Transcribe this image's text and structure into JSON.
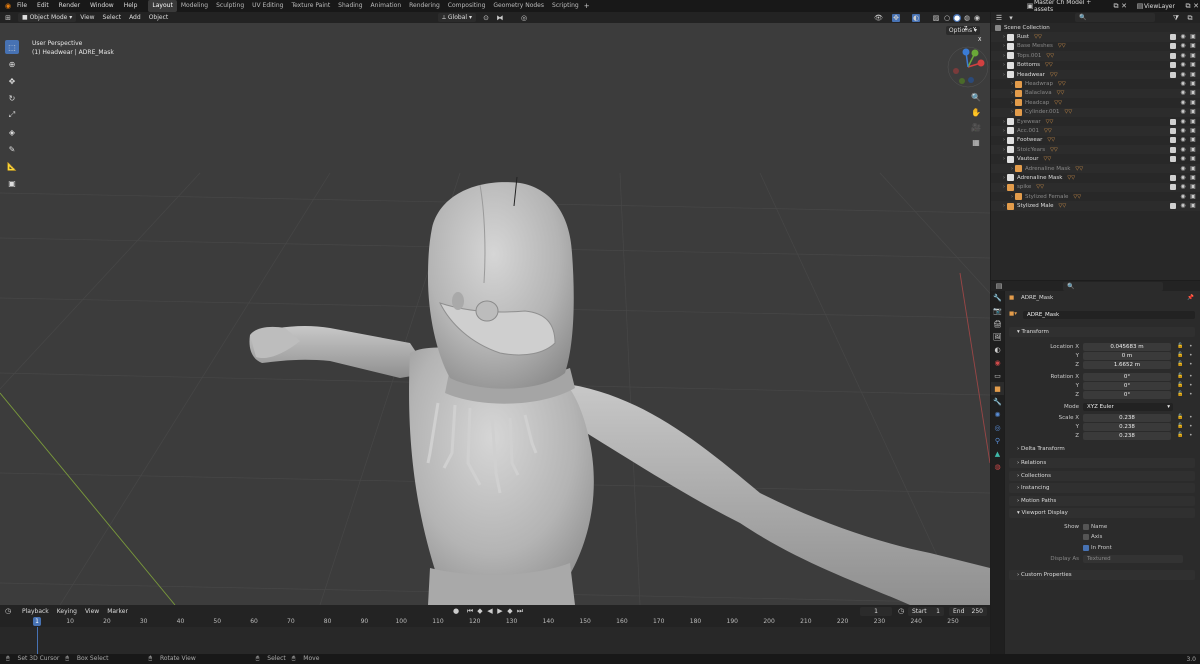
{
  "topbar": {
    "menus": [
      "File",
      "Edit",
      "Render",
      "Window",
      "Help"
    ],
    "workspaces": [
      "Layout",
      "Modeling",
      "Sculpting",
      "UV Editing",
      "Texture Paint",
      "Shading",
      "Animation",
      "Rendering",
      "Compositing",
      "Geometry Nodes",
      "Scripting"
    ],
    "active_workspace": "Layout",
    "scene_name": "Master Ch Model + assets",
    "view_layer": "ViewLayer"
  },
  "viewport_header": {
    "mode": "Object Mode",
    "menus": [
      "View",
      "Select",
      "Add",
      "Object"
    ],
    "transform_orientation": "Global",
    "options": "Options"
  },
  "viewport": {
    "perspective": "User Perspective",
    "object_info": "(1) Headwear | ADRE_Mask",
    "gizmo": {
      "x": "X",
      "y": "Y",
      "z": "Z"
    }
  },
  "timeline": {
    "menus": [
      "Playback",
      "Keying",
      "View",
      "Marker"
    ],
    "current_frame": "1",
    "start_label": "Start",
    "start": "1",
    "end_label": "End",
    "end": "250",
    "ticks": [
      "1",
      "10",
      "20",
      "30",
      "40",
      "50",
      "60",
      "70",
      "80",
      "90",
      "100",
      "110",
      "120",
      "130",
      "140",
      "150",
      "160",
      "170",
      "180",
      "190",
      "200",
      "210",
      "220",
      "230",
      "240",
      "250"
    ]
  },
  "statusbar": {
    "items": [
      "Set 3D Cursor",
      "Box Select",
      "Rotate View",
      "Select",
      "Move"
    ],
    "version": "3.0"
  },
  "outliner": {
    "root": "Scene Collection",
    "rows": [
      {
        "name": "Rust",
        "depth": 0,
        "dim": false,
        "icon_color": "#e0e0e0"
      },
      {
        "name": "Base Meshes",
        "depth": 0,
        "dim": true,
        "icon_color": "#e0e0e0"
      },
      {
        "name": "Tops.001",
        "depth": 0,
        "dim": true,
        "icon_color": "#e0e0e0"
      },
      {
        "name": "Bottoms",
        "depth": 0,
        "dim": false,
        "icon_color": "#e0e0e0"
      },
      {
        "name": "Headwear",
        "depth": 0,
        "dim": false,
        "icon_color": "#e0e0e0"
      },
      {
        "name": "Headwrap",
        "depth": 1,
        "dim": true,
        "icon_color": "#e39c4b"
      },
      {
        "name": "Balaclava",
        "depth": 1,
        "dim": true,
        "icon_color": "#e39c4b"
      },
      {
        "name": "Headcap",
        "depth": 1,
        "dim": true,
        "icon_color": "#e39c4b"
      },
      {
        "name": "Cylinder.001",
        "depth": 1,
        "dim": true,
        "icon_color": "#e39c4b"
      },
      {
        "name": "Eyewear",
        "depth": 0,
        "dim": true,
        "icon_color": "#e0e0e0"
      },
      {
        "name": "Acc.001",
        "depth": 0,
        "dim": true,
        "icon_color": "#e0e0e0"
      },
      {
        "name": "Footwear",
        "depth": 0,
        "dim": false,
        "icon_color": "#e0e0e0"
      },
      {
        "name": "StoicYears",
        "depth": 0,
        "dim": true,
        "icon_color": "#e0e0e0"
      },
      {
        "name": "Vautour",
        "depth": 0,
        "dim": false,
        "icon_color": "#e0e0e0"
      },
      {
        "name": "Adrenaline Mask",
        "depth": 1,
        "dim": true,
        "icon_color": "#e39c4b"
      },
      {
        "name": "Adrenaline Mask",
        "depth": 0,
        "dim": false,
        "icon_color": "#e0e0e0"
      },
      {
        "name": "spike",
        "depth": 0,
        "dim": true,
        "icon_color": "#e39c4b"
      },
      {
        "name": "Stylized Female",
        "depth": 1,
        "dim": true,
        "icon_color": "#e39c4b"
      },
      {
        "name": "Stylized Male",
        "depth": 0,
        "dim": false,
        "icon_color": "#e39c4b"
      }
    ]
  },
  "properties": {
    "object_name": "ADRE_Mask",
    "datablock": "ADRE_Mask",
    "transform": {
      "title": "Transform",
      "location_label": "Location X",
      "location": [
        "0.045683 m",
        "0 m",
        "1.6652 m"
      ],
      "rotation_label": "Rotation X",
      "rotation": [
        "0°",
        "0°",
        "0°"
      ],
      "mode_label": "Mode",
      "mode": "XYZ Euler",
      "scale_label": "Scale X",
      "scale": [
        "0.238",
        "0.238",
        "0.238"
      ],
      "axis_y": "Y",
      "axis_z": "Z"
    },
    "delta_transform": "Delta Transform",
    "panels": [
      "Relations",
      "Collections",
      "Instancing",
      "Motion Paths"
    ],
    "viewport_display": {
      "title": "Viewport Display",
      "show_label": "Show",
      "name": "Name",
      "axis": "Axis",
      "in_front": "In Front",
      "display_as_label": "Display As",
      "display_as": "Textured"
    },
    "custom_properties": "Custom Properties"
  }
}
